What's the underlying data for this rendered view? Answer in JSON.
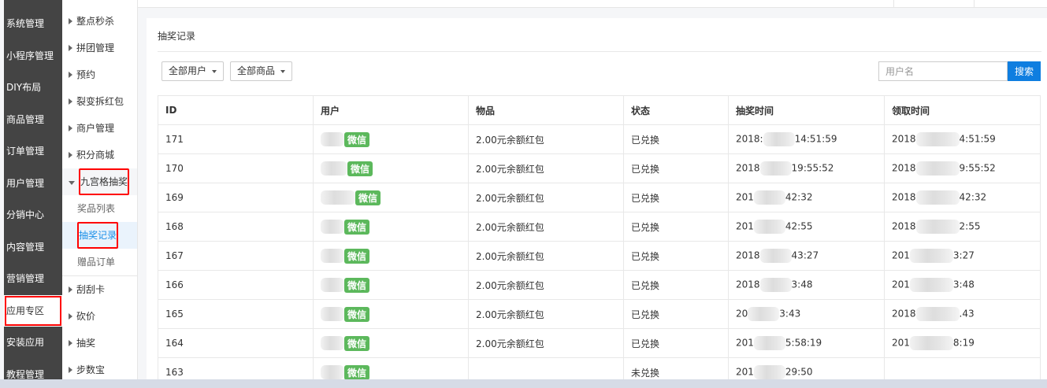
{
  "sidebar": [
    "系统管理",
    "小程序管理",
    "DIY布局",
    "商品管理",
    "订单管理",
    "用户管理",
    "分销中心",
    "内容管理",
    "营销管理",
    "应用专区",
    "安装应用",
    "教程管理"
  ],
  "subnav": {
    "before": [
      "整点秒杀",
      "拼团管理",
      "预约",
      "裂变拆红包",
      "商户管理",
      "积分商城"
    ],
    "open": "九宫格抽奖",
    "children": [
      "奖品列表",
      "抽奖记录",
      "赠品订单"
    ],
    "after": [
      "刮刮卡",
      "砍价",
      "抽奖",
      "步数宝"
    ]
  },
  "page": {
    "title": "抽奖记录",
    "filter_user": "全部用户",
    "filter_goods": "全部商品",
    "search_placeholder": "用户名",
    "search_button": "搜索"
  },
  "table": {
    "headers": [
      "ID",
      "用户",
      "物品",
      "状态",
      "抽奖时间",
      "领取时间"
    ],
    "badge": "微信",
    "rows": [
      {
        "id": "171",
        "item": "2.00元余额红包",
        "status": "已兑换",
        "draw": [
          "2018:",
          "14:51:59"
        ],
        "claim": [
          "2018",
          "4:51:59"
        ]
      },
      {
        "id": "170",
        "item": "2.00元余额红包",
        "status": "已兑换",
        "draw": [
          "2018",
          "19:55:52"
        ],
        "claim": [
          "2018",
          "9:55:52"
        ]
      },
      {
        "id": "169",
        "item": "2.00元余额红包",
        "status": "已兑换",
        "draw": [
          "201",
          "42:32"
        ],
        "claim": [
          "2018",
          "42:32"
        ]
      },
      {
        "id": "168",
        "item": "2.00元余额红包",
        "status": "已兑换",
        "draw": [
          "201",
          "42:55"
        ],
        "claim": [
          "2018",
          "2:55"
        ]
      },
      {
        "id": "167",
        "item": "2.00元余额红包",
        "status": "已兑换",
        "draw": [
          "2018",
          "43:27"
        ],
        "claim": [
          "201",
          "3:27"
        ]
      },
      {
        "id": "166",
        "item": "2.00元余额红包",
        "status": "已兑换",
        "draw": [
          "2018",
          "3:48"
        ],
        "claim": [
          "201",
          "3:48"
        ]
      },
      {
        "id": "165",
        "item": "2.00元余额红包",
        "status": "已兑换",
        "draw": [
          "20",
          "3:43"
        ],
        "claim": [
          "2018",
          ".43"
        ]
      },
      {
        "id": "164",
        "item": "2.00元余额红包",
        "status": "已兑换",
        "draw": [
          "201",
          "5:58:19"
        ],
        "claim": [
          "201",
          "8:19"
        ]
      },
      {
        "id": "163",
        "item": "",
        "status": "未兑换",
        "draw": [
          "201",
          "29:50"
        ],
        "claim": [
          "",
          ""
        ]
      }
    ]
  }
}
